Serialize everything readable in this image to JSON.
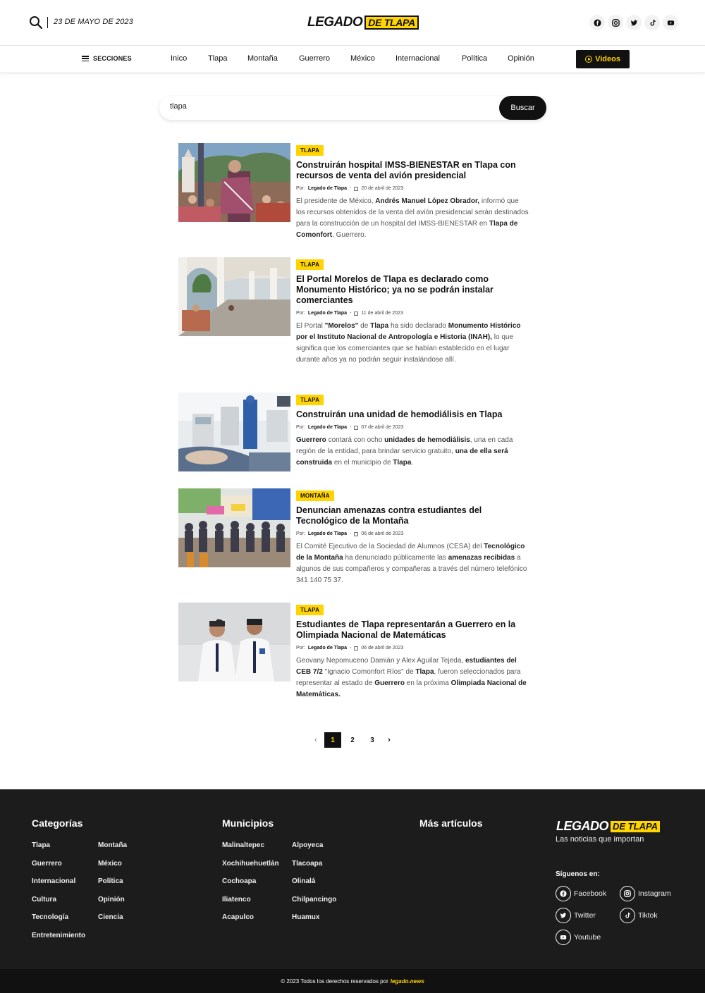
{
  "header": {
    "date": "23 DE MAYO DE 2023",
    "logo_part1": "LEGADO",
    "logo_part2": "DE TLAPA",
    "social_icons": [
      "facebook-icon",
      "instagram-icon",
      "twitter-icon",
      "tiktok-icon",
      "youtube-icon"
    ]
  },
  "nav": {
    "secciones": "SECCIONES",
    "items": [
      "Inico",
      "Tlapa",
      "Montaña",
      "Guerrero",
      "México",
      "Internacional",
      "Política",
      "Opinión"
    ],
    "videos": "Videos"
  },
  "search": {
    "value": "tlapa",
    "button": "Buscar"
  },
  "articles": [
    {
      "category": "TLAPA",
      "title": "Construirán hospital IMSS-BIENESTAR en Tlapa con recursos de venta del avión presidencial",
      "author_prefix": "Por:",
      "author": "Legado de Tlapa",
      "date": "20 de abril de 2023",
      "excerpt_parts": [
        "El presidente de México, ",
        "Andrés Manuel López Obrador,",
        " informó que los recursos obtenidos de la venta del avión presidencial serán destinados para la construcción de un hospital del IMSS-BIENESTAR en ",
        "Tlapa de Comonfort",
        ", Guerrero."
      ]
    },
    {
      "category": "TLAPA",
      "title": "El Portal Morelos de Tlapa es declarado como Monumento Histórico; ya no se podrán instalar comerciantes",
      "author_prefix": "Por:",
      "author": "Legado de Tlapa",
      "date": "11 de abril de 2023",
      "excerpt_parts": [
        "El Portal ",
        "\"Morelos\"",
        " de ",
        "Tlapa",
        " ha sido declarado ",
        "Monumento Histórico por el Instituto Nacional de Antropología e Historia (INAH),",
        " lo que significa que los comerciantes que se habían establecido en el lugar durante años ya no podrán seguir instalándose allí."
      ]
    },
    {
      "category": "TLAPA",
      "title": "Construirán una unidad de hemodiálisis en Tlapa",
      "author_prefix": "Por:",
      "author": "Legado de Tlapa",
      "date": "07 de abril de 2023",
      "excerpt_parts": [
        "Guerrero",
        " contará con ocho ",
        "unidades de hemodiálisis",
        ", una en cada región de la entidad, para brindar servicio gratuito, ",
        "una de ella será construida",
        " en el municipio de ",
        "Tlapa",
        "."
      ]
    },
    {
      "category": "MONTAÑA",
      "title": "Denuncian amenazas contra estudiantes del Tecnológico de la Montaña",
      "author_prefix": "Por:",
      "author": "Legado de Tlapa",
      "date": "06 de abril de 2023",
      "excerpt_parts": [
        "El Comité Ejecutivo de la Sociedad de Alumnos (CESA) del ",
        "Tecnológico de la Montaña",
        " ha denunciado públicamente las ",
        "amenazas recibidas",
        " a algunos de sus compañeros y compañeras a través del número telefónico 341 140 75 37."
      ]
    },
    {
      "category": "TLAPA",
      "title": "Estudiantes de Tlapa representarán a Guerrero en la Olimpiada Nacional de Matemáticas",
      "author_prefix": "Por:",
      "author": "Legado de Tlapa",
      "date": "06 de abril de 2023",
      "excerpt_parts": [
        "Geovany Nepomuceno Damián y Alex Aguilar Tejeda, ",
        "estudiantes del CEB 7/2",
        " \"Ignacio Comonfort Ríos\" de ",
        "Tlapa",
        ", fueron seleccionados para representar al estado de ",
        "Guerrero",
        " en la próxima ",
        "Olimpiada Nacional de Matemáticas."
      ]
    }
  ],
  "pagination": {
    "prev": "‹",
    "pages": [
      "1",
      "2",
      "3"
    ],
    "active": "1",
    "next": "›"
  },
  "footer": {
    "categorias_title": "Categorías",
    "categorias": [
      "Tlapa",
      "Montaña",
      "Guerrero",
      "México",
      "Internacional",
      "Política",
      "Cultura",
      "Opinión",
      "Tecnología",
      "Ciencia",
      "Entretenimiento"
    ],
    "municipios_title": "Municipios",
    "municipios": [
      "Malinaltepec",
      "Alpoyeca",
      "Xochihuehuetlán",
      "Tlacoapa",
      "Cochoapa",
      "Olinalá",
      "Iliatenco",
      "Chilpancingo",
      "Acapulco",
      "Huamux"
    ],
    "mas_title": "Más artículos",
    "logo_part1": "LEGADO",
    "logo_part2": "DE TLAPA",
    "tagline": "Las noticias que importan",
    "siguenos": "Síguenos en:",
    "social": [
      "Facebook",
      "Instagram",
      "Twitter",
      "Tiktok",
      "Youtube"
    ]
  },
  "copyright": {
    "text": "© 2023 Todos los derechos reservados por",
    "site": "legado.news"
  }
}
